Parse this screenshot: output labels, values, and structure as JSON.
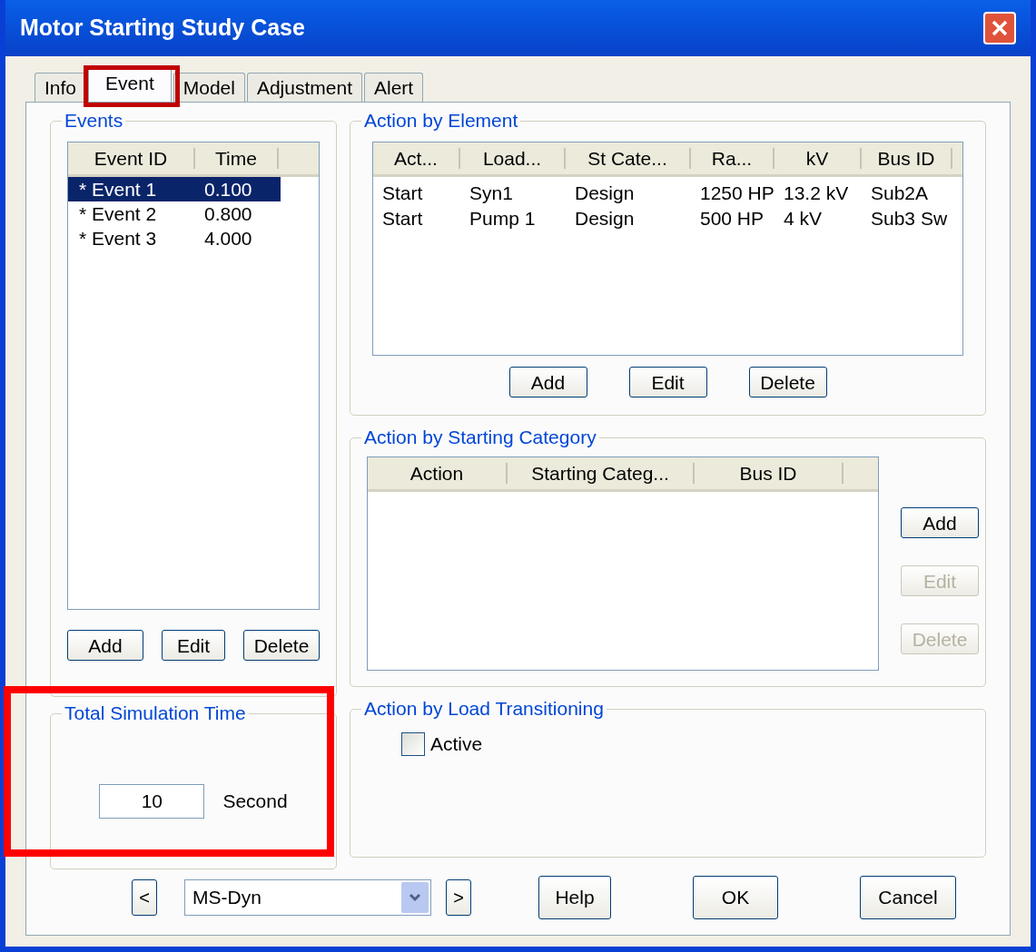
{
  "window": {
    "title": "Motor Starting Study Case"
  },
  "tabs": [
    {
      "label": "Info",
      "selected": false
    },
    {
      "label": "Event",
      "selected": true
    },
    {
      "label": "Model",
      "selected": false
    },
    {
      "label": "Adjustment",
      "selected": false
    },
    {
      "label": "Alert",
      "selected": false
    }
  ],
  "events": {
    "title": "Events",
    "columns": [
      "Event ID",
      "Time"
    ],
    "rows": [
      {
        "cells": [
          "* Event 1",
          "0.100"
        ],
        "selected": true
      },
      {
        "cells": [
          "* Event 2",
          "0.800"
        ],
        "selected": false
      },
      {
        "cells": [
          "* Event 3",
          "4.000"
        ],
        "selected": false
      }
    ],
    "buttons": [
      {
        "label": "Add",
        "disabled": false
      },
      {
        "label": "Edit",
        "disabled": false
      },
      {
        "label": "Delete",
        "disabled": false
      }
    ]
  },
  "action_by_element": {
    "title": "Action by Element",
    "columns": [
      "Act...",
      "Load...",
      "St Cate...",
      "Ra...",
      "kV",
      "Bus ID"
    ],
    "rows": [
      {
        "cells": [
          "Start",
          "Syn1",
          "Design",
          "1250 HP",
          "13.2 kV",
          "Sub2A"
        ]
      },
      {
        "cells": [
          "Start",
          "Pump 1",
          "Design",
          "500 HP",
          "4 kV",
          "Sub3 Sw"
        ]
      }
    ],
    "buttons": [
      {
        "label": "Add",
        "disabled": false
      },
      {
        "label": "Edit",
        "disabled": false
      },
      {
        "label": "Delete",
        "disabled": false
      }
    ]
  },
  "action_by_starting_category": {
    "title": "Action by Starting Category",
    "columns": [
      "Action",
      "Starting Categ...",
      "Bus ID"
    ],
    "buttons": [
      {
        "label": "Add",
        "disabled": false
      },
      {
        "label": "Edit",
        "disabled": true
      },
      {
        "label": "Delete",
        "disabled": true
      }
    ]
  },
  "total_simulation_time": {
    "title": "Total Simulation Time",
    "value": "10",
    "unit": "Second"
  },
  "action_by_load_transitioning": {
    "title": "Action by Load Transitioning",
    "checkbox": {
      "label": "Active",
      "checked": false
    }
  },
  "footer": {
    "prev_button": "<",
    "dropdown": {
      "value": "MS-Dyn"
    },
    "next_button": ">",
    "buttons": [
      {
        "label": "Help"
      },
      {
        "label": "OK"
      },
      {
        "label": "Cancel"
      }
    ]
  }
}
